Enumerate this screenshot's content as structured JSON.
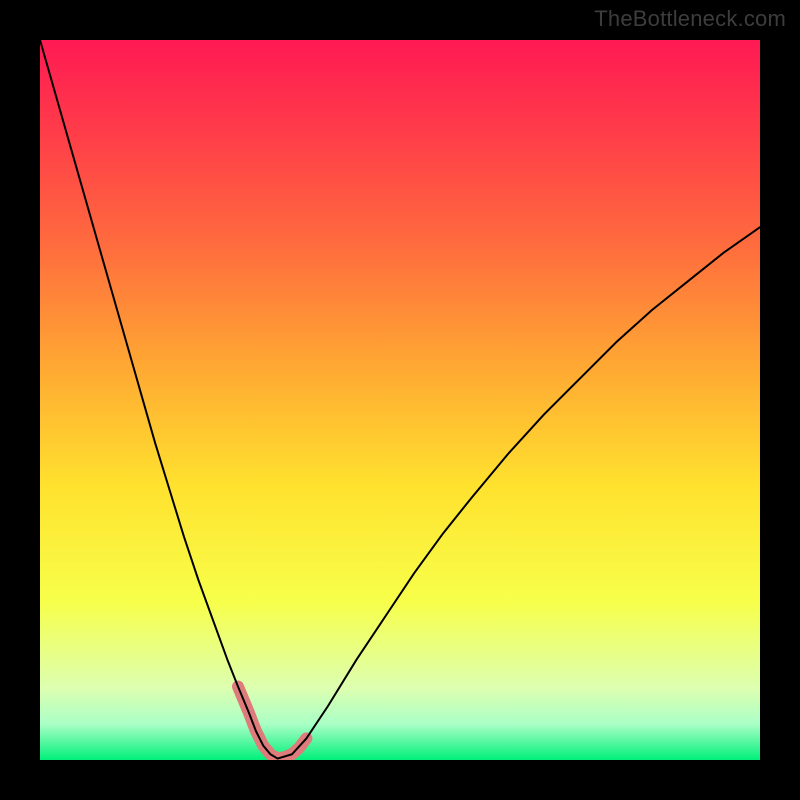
{
  "watermark": "TheBottleneck.com",
  "chart_data": {
    "type": "line",
    "title": "",
    "xlabel": "",
    "ylabel": "",
    "xlim": [
      0,
      100
    ],
    "ylim": [
      0,
      100
    ],
    "grid": false,
    "legend": false,
    "background": {
      "type": "vertical-gradient",
      "stops": [
        {
          "offset": 0.0,
          "color": "#ff1a53"
        },
        {
          "offset": 0.12,
          "color": "#ff3a4a"
        },
        {
          "offset": 0.28,
          "color": "#ff6a3e"
        },
        {
          "offset": 0.45,
          "color": "#ffa733"
        },
        {
          "offset": 0.62,
          "color": "#ffe22e"
        },
        {
          "offset": 0.78,
          "color": "#f7ff4a"
        },
        {
          "offset": 0.9,
          "color": "#ddffb0"
        },
        {
          "offset": 0.95,
          "color": "#aaffc6"
        },
        {
          "offset": 1.0,
          "color": "#00f07a"
        }
      ]
    },
    "series": [
      {
        "name": "bottleneck-curve",
        "color": "#000000",
        "stroke_width": 2,
        "x": [
          0.0,
          2.0,
          4.0,
          6.0,
          8.0,
          10.0,
          12.0,
          14.0,
          16.0,
          18.0,
          20.0,
          22.0,
          24.0,
          26.0,
          27.5,
          29.0,
          30.0,
          31.0,
          32.0,
          33.0,
          35.0,
          37.0,
          40.0,
          44.0,
          48.0,
          52.0,
          56.0,
          60.0,
          65.0,
          70.0,
          75.0,
          80.0,
          85.0,
          90.0,
          95.0,
          100.0
        ],
        "values": [
          100.0,
          93.0,
          86.0,
          79.0,
          72.0,
          65.0,
          58.0,
          51.0,
          44.0,
          37.5,
          31.0,
          25.0,
          19.5,
          14.0,
          10.2,
          6.6,
          4.0,
          2.0,
          0.8,
          0.2,
          0.8,
          3.0,
          7.5,
          14.0,
          20.0,
          26.0,
          31.5,
          36.5,
          42.5,
          48.0,
          53.0,
          58.0,
          62.5,
          66.5,
          70.5,
          74.0
        ]
      }
    ],
    "highlight": {
      "name": "bottom-segment",
      "color": "#de7b7b",
      "stroke_width": 12,
      "linecap": "round",
      "x": [
        27.5,
        29.0,
        30.0,
        31.0,
        32.0,
        33.0,
        34.0,
        35.0,
        36.0,
        37.0
      ],
      "values": [
        10.2,
        6.6,
        4.0,
        2.0,
        0.8,
        0.2,
        0.4,
        0.8,
        1.7,
        3.0
      ]
    },
    "optimum_x": 33.0
  }
}
